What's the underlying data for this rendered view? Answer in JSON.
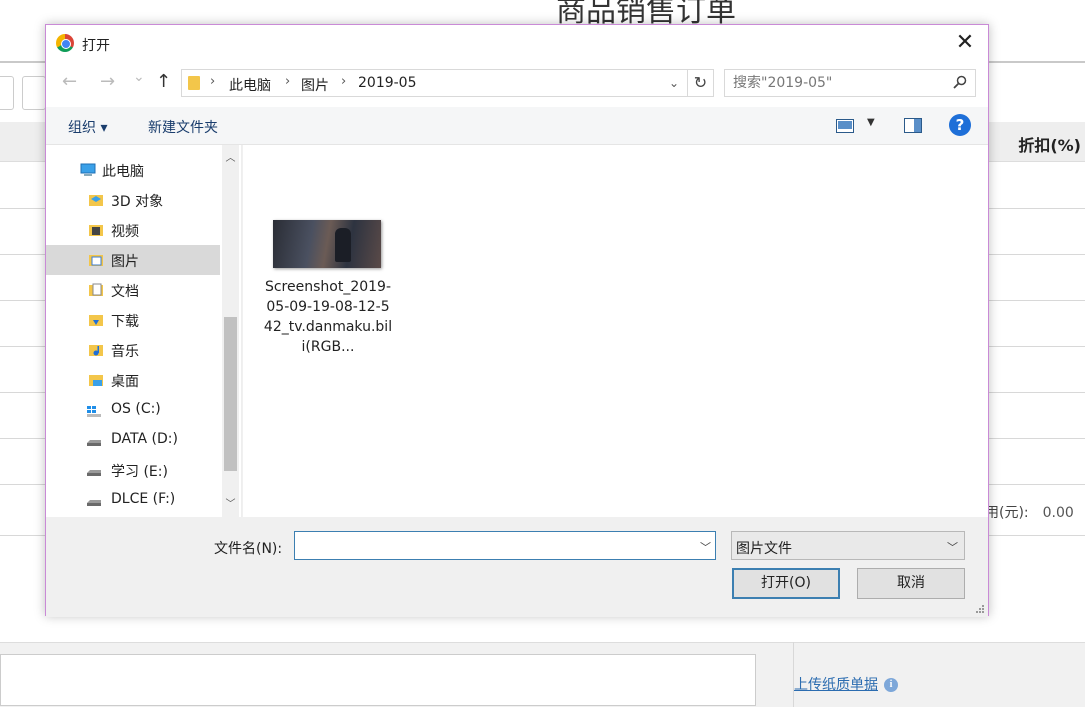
{
  "background": {
    "page_title": "商品销售订单",
    "column_discount": "折扣(%)",
    "fee_label": "用(元):",
    "fee_value": "0.00",
    "upload_link": "上传纸质单据",
    "info_icon": "info-icon"
  },
  "dialog": {
    "title": "打开",
    "close_glyph": "✕",
    "nav": {
      "back": "←",
      "forward": "→",
      "recent": "⌄",
      "up": "↑"
    },
    "address": {
      "crumbs": [
        "此电脑",
        "图片",
        "2019-05"
      ]
    },
    "search": {
      "placeholder": "搜索\"2019-05\""
    },
    "toolbar": {
      "organize": "组织 ▾",
      "new_folder": "新建文件夹",
      "help": "?"
    },
    "tree": [
      {
        "label": "此电脑",
        "icon": "computer-icon"
      },
      {
        "label": "3D 对象",
        "icon": "3d-objects-icon"
      },
      {
        "label": "视频",
        "icon": "videos-icon"
      },
      {
        "label": "图片",
        "icon": "pictures-icon",
        "selected": true
      },
      {
        "label": "文档",
        "icon": "documents-icon"
      },
      {
        "label": "下载",
        "icon": "downloads-icon"
      },
      {
        "label": "音乐",
        "icon": "music-icon"
      },
      {
        "label": "桌面",
        "icon": "desktop-icon"
      },
      {
        "label": "OS (C:)",
        "icon": "os-drive-icon"
      },
      {
        "label": "DATA (D:)",
        "icon": "drive-icon"
      },
      {
        "label": "学习 (E:)",
        "icon": "drive-icon"
      },
      {
        "label": "DLCE (F:)",
        "icon": "drive-icon"
      }
    ],
    "files": [
      {
        "name": "Screenshot_2019-05-09-19-08-12-542_tv.danmaku.bili(RGB..."
      }
    ],
    "filename_label": "文件名(N):",
    "filename_value": "",
    "filetype": "图片文件",
    "open_button": "打开(O)",
    "cancel_button": "取消"
  }
}
